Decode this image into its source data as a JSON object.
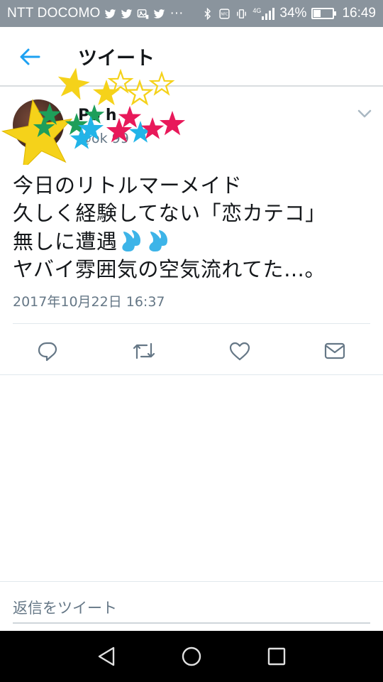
{
  "status_bar": {
    "carrier": "NTT DOCOMO",
    "more": "···",
    "network": "4G",
    "battery": "34%",
    "battery_level": 0.34,
    "time": "16:49"
  },
  "header": {
    "title": "ツイート"
  },
  "tweet": {
    "author_name": "Po  h",
    "author_handle": "@ok   99",
    "text_lines": [
      "今日のリトルマーメイド",
      "久しく経験してない「恋カテコ」",
      "無しに遭遇",
      "ヤバイ雰囲気の空気流れてた…。"
    ],
    "timestamp": "2017年10月22日 16:37"
  },
  "reply": {
    "placeholder": "返信をツイート"
  },
  "colors": {
    "accent": "#1da1f2",
    "muted": "#657786",
    "status_bar": "#8a949d"
  },
  "icons": {
    "back": "arrow-left-icon",
    "menu": "chevron-down-icon",
    "reply": "reply-icon",
    "retweet": "retweet-icon",
    "like": "heart-icon",
    "dm": "mail-icon",
    "nav_back": "triangle-back-icon",
    "nav_home": "circle-home-icon",
    "nav_recent": "square-recent-icon"
  }
}
